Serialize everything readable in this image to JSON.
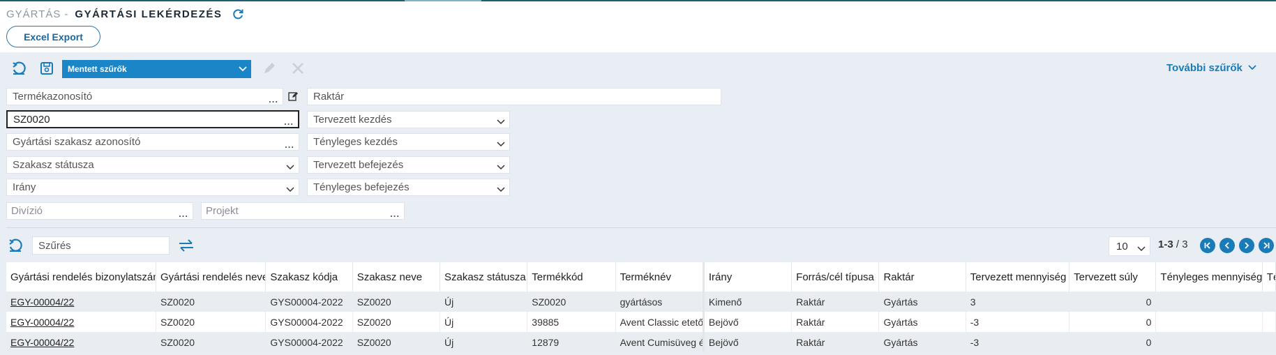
{
  "header": {
    "module": "GYÁRTÁS",
    "separator": "-",
    "title": "GYÁRTÁSI LEKÉRDEZÉS"
  },
  "actions": {
    "excel_export": "Excel Export"
  },
  "saved_filters": {
    "label": "Mentett szűrők"
  },
  "more_filters": {
    "label": "További szűrők"
  },
  "filters": {
    "termekazonosito": "Termékazonosító",
    "raktar": "Raktár",
    "sz_value": "SZ0020",
    "tervezett_kezdes": "Tervezett kezdés",
    "gyartasi_szakasz": "Gyártási szakasz azonosító",
    "tenyleges_kezdes": "Tényleges kezdés",
    "szakasz_statusza": "Szakasz státusza",
    "tervezett_befejezes": "Tervezett befejezés",
    "irany": "Irány",
    "tenyleges_befejezes": "Tényleges befejezés",
    "divizio": "Divízió",
    "projekt": "Projekt",
    "ellipsis": "..."
  },
  "grid": {
    "search_placeholder": "Szűrés",
    "page_size": "10",
    "range": "1-3",
    "total": "/ 3",
    "columns": [
      "Gyártási rendelés bizonylatszáma",
      "Gyártási rendelés neve",
      "Szakasz kódja",
      "Szakasz neve",
      "Szakasz státusza",
      "Termékkód",
      "Terméknév",
      "Irány",
      "Forrás/cél típusa",
      "Raktár",
      "Tervezett mennyiség",
      "Tervezett súly",
      "Tényleges mennyiség",
      "Té"
    ],
    "rows": [
      [
        "EGY-00004/22",
        "SZ0020",
        "GYS00004-2022",
        "SZ0020",
        "Új",
        "SZ0020",
        "gyártásos",
        "Kimenő",
        "Raktár",
        "Gyártás",
        "3",
        "0",
        "",
        ""
      ],
      [
        "EGY-00004/22",
        "SZ0020",
        "GYS00004-2022",
        "SZ0020",
        "Új",
        "39885",
        "Avent Classic etetőcumi",
        "Bejövő",
        "Raktár",
        "Gyártás",
        "-3",
        "0",
        "",
        ""
      ],
      [
        "EGY-00004/22",
        "SZ0020",
        "GYS00004-2022",
        "SZ0020",
        "Új",
        "12879",
        "Avent Cumisüveg éjszakai",
        "Bejövő",
        "Raktár",
        "Gyártás",
        "-3",
        "0",
        "",
        ""
      ]
    ]
  },
  "colors": {
    "accent": "#1a7bb9",
    "header_dark": "#1d2a36",
    "panel_bg": "#e8eef3"
  }
}
